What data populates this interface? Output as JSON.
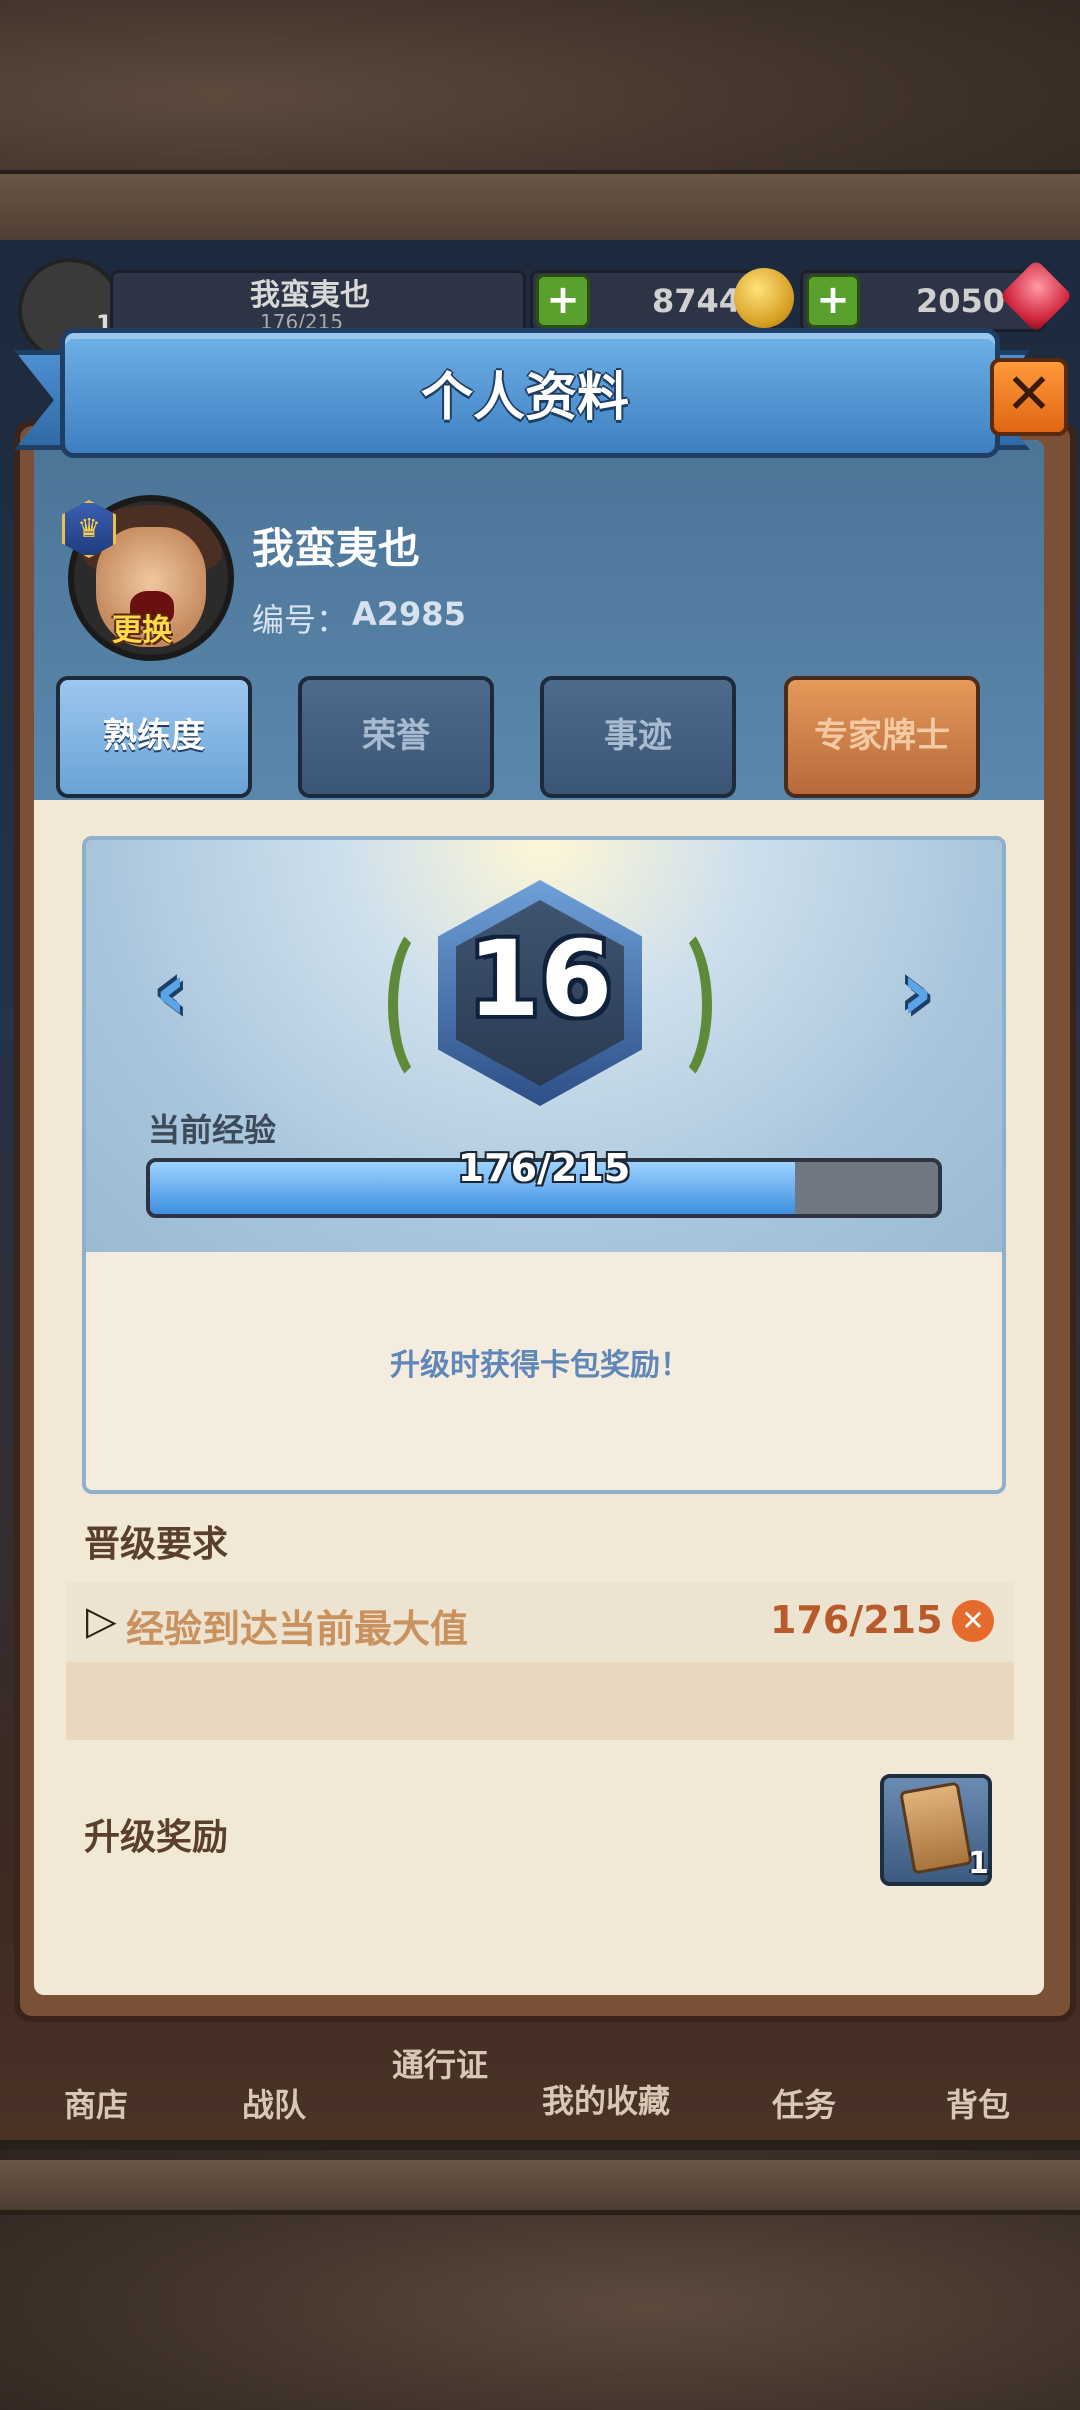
{
  "hud": {
    "player_name": "我蛮夷也",
    "player_level": "16",
    "exp_text": "176/215",
    "gold": "8744",
    "gems": "2050"
  },
  "bottom_nav": [
    "商店",
    "战队",
    "通行证",
    "我的收藏",
    "任务",
    "背包"
  ],
  "modal": {
    "title": "个人资料",
    "close_label": "✕",
    "avatar_change_label": "更换",
    "player_name": "我蛮夷也",
    "id_label": "编号：",
    "id_value": "A2985",
    "tabs": [
      {
        "label": "熟练度",
        "active": true
      },
      {
        "label": "荣誉",
        "active": false
      },
      {
        "label": "事迹",
        "active": false
      },
      {
        "label": "专家牌士",
        "active": false
      }
    ],
    "level": {
      "value": "16",
      "exp_label": "当前经验",
      "exp_text": "176/215",
      "exp_current": 176,
      "exp_max": 215,
      "reward_hint": "升级时获得卡包奖励！"
    },
    "requirements": {
      "title": "晋级要求",
      "items": [
        {
          "text": "经验到达当前最大值",
          "value": "176/215",
          "status": "incomplete"
        }
      ]
    },
    "rewards": {
      "title": "升级奖励",
      "item_count": "1"
    }
  },
  "colors": {
    "accent_blue": "#3e8fe0",
    "orange": "#e06514",
    "parchment": "#f2e8d6"
  },
  "icons": {
    "left_arrow": "‹",
    "right_arrow": "›",
    "close": "✕",
    "crown": "♛",
    "play": "▷"
  }
}
